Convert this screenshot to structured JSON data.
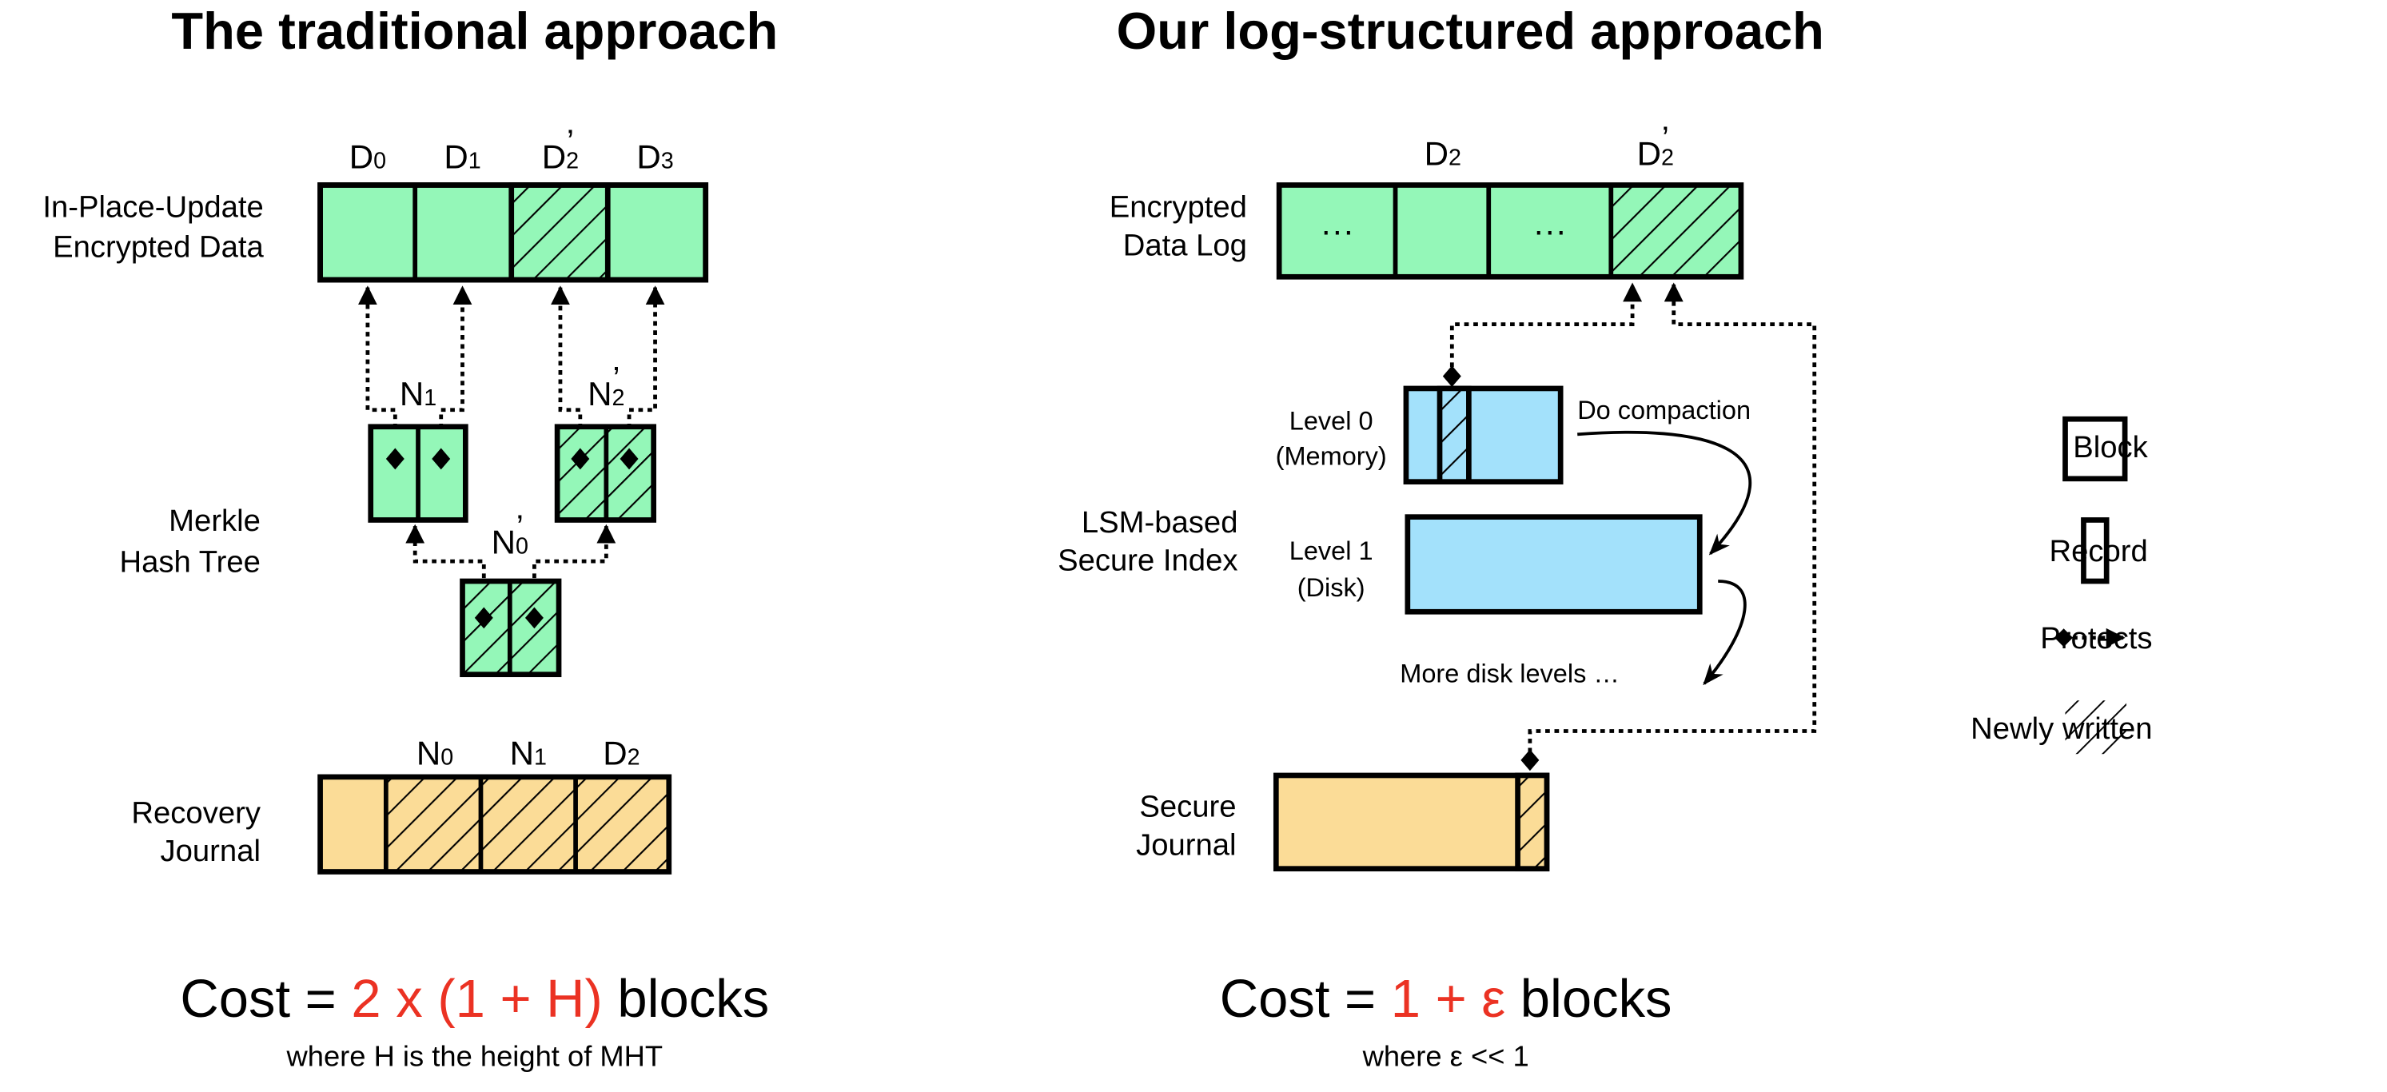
{
  "colors": {
    "green": "#94f7b8",
    "blue": "#a3e1fb",
    "yellow": "#fbdc97",
    "red": "#eb3223"
  },
  "left": {
    "title": "The traditional approach",
    "data_label": [
      "In-Place-Update",
      "Encrypted Data"
    ],
    "data_cells": [
      {
        "base": "D",
        "sub": "0",
        "prime": ""
      },
      {
        "base": "D",
        "sub": "1",
        "prime": ""
      },
      {
        "base": "D",
        "sub": "2",
        "prime": "’"
      },
      {
        "base": "D",
        "sub": "3",
        "prime": ""
      }
    ],
    "tree_label": [
      "Merkle",
      "Hash Tree"
    ],
    "nodes": {
      "n1": {
        "base": "N",
        "sub": "1",
        "prime": ""
      },
      "n2": {
        "base": "N",
        "sub": "2",
        "prime": "’"
      },
      "n0": {
        "base": "N",
        "sub": "0",
        "prime": "’"
      }
    },
    "journal_label": [
      "Recovery",
      "Journal"
    ],
    "journal_cells": [
      {
        "base": "N",
        "sub": "0"
      },
      {
        "base": "N",
        "sub": "1"
      },
      {
        "base": "D",
        "sub": "2"
      }
    ],
    "cost": {
      "prefix": "Cost = ",
      "highlight": "2 x (1 + H)",
      "suffix": " blocks",
      "note": "where H is the height of MHT"
    }
  },
  "right": {
    "title": "Our log-structured approach",
    "log_label": [
      "Encrypted",
      "Data Log"
    ],
    "log_cells": {
      "ellipsis": "···",
      "d2": {
        "base": "D",
        "sub": "2",
        "prime": ""
      },
      "d2p": {
        "base": "D",
        "sub": "2",
        "prime": "’"
      }
    },
    "index_label": [
      "LSM-based",
      "Secure Index"
    ],
    "level0": [
      "Level 0",
      "(Memory)"
    ],
    "level1": [
      "Level 1",
      "(Disk)"
    ],
    "compaction": "Do compaction",
    "more_levels": "More disk levels …",
    "journal_label": [
      "Secure",
      "Journal"
    ],
    "cost": {
      "prefix": "Cost = ",
      "highlight": "1 + ε",
      "suffix": " blocks",
      "note": "where ε << 1"
    }
  },
  "legend": {
    "block": "Block",
    "record": "Record",
    "protects": "Protects",
    "newly_written": "Newly written"
  }
}
